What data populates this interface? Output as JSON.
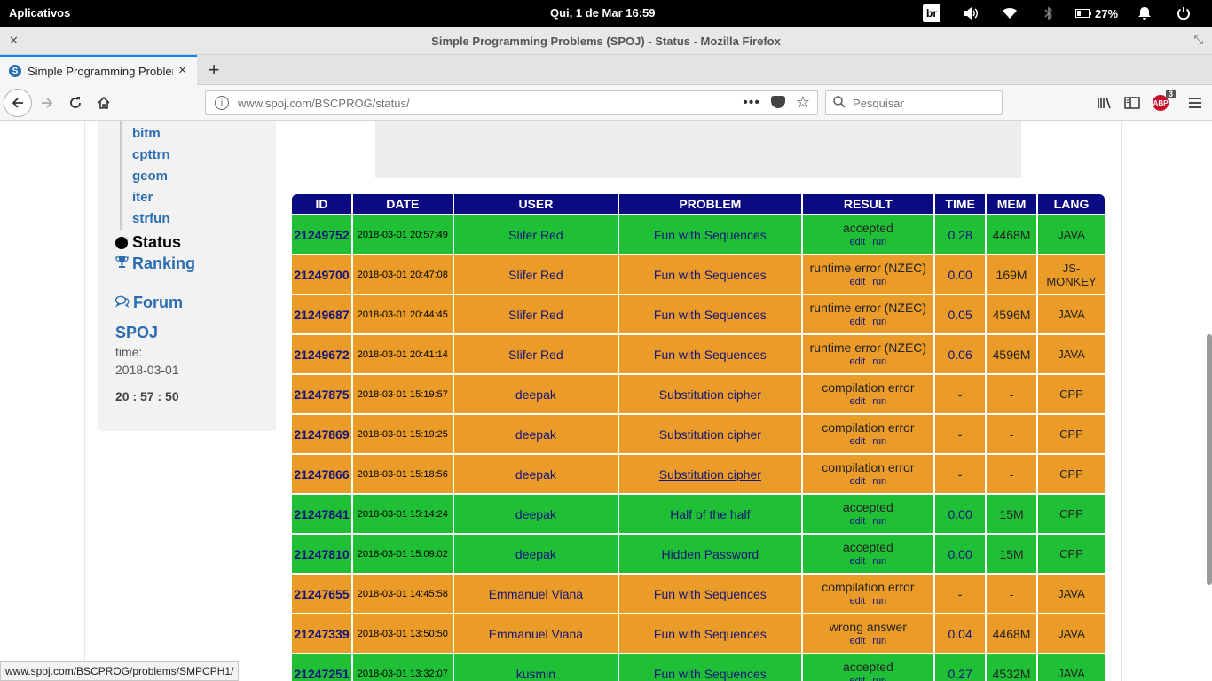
{
  "system_bar": {
    "apps_label": "Aplicativos",
    "clock": "Qui,  1 de Mar    16:59",
    "keyboard_layout": "br",
    "battery": "27%"
  },
  "window": {
    "title": "Simple Programming Problems (SPOJ) - Status - Mozilla Firefox"
  },
  "tab": {
    "title": "Simple Programming Problem",
    "favicon": "S"
  },
  "navbar": {
    "url_host": "www.spoj.com",
    "url_path": "/BSCPROG/status/",
    "search_placeholder": "Pesquisar",
    "addon_badge": "3",
    "addon_label": "ABP"
  },
  "sidebar": {
    "sub_items": [
      "bitm",
      "cpttrn",
      "geom",
      "iter",
      "strfun"
    ],
    "status_label": "Status",
    "ranking_label": "Ranking",
    "forum_label": "Forum",
    "spoj_title": "SPOJ",
    "time_label": "time:",
    "date": "2018-03-01",
    "clock": "20 : 57 : 50"
  },
  "table": {
    "headers": [
      "ID",
      "DATE",
      "USER",
      "PROBLEM",
      "RESULT",
      "TIME",
      "MEM",
      "LANG"
    ],
    "edit_label": "edit",
    "run_label": "run",
    "rows": [
      {
        "id": "21249752",
        "date": "2018-03-01 20:57:49",
        "user": "Slifer Red",
        "problem": "Fun with Sequences",
        "result": "accepted",
        "time": "0.28",
        "mem": "4468M",
        "lang": "JAVA",
        "status": "ok"
      },
      {
        "id": "21249700",
        "date": "2018-03-01 20:47:08",
        "user": "Slifer Red",
        "problem": "Fun with Sequences",
        "result": "runtime error (NZEC)",
        "time": "0.00",
        "mem": "169M",
        "lang": "JS-MONKEY",
        "status": "bad"
      },
      {
        "id": "21249687",
        "date": "2018-03-01 20:44:45",
        "user": "Slifer Red",
        "problem": "Fun with Sequences",
        "result": "runtime error (NZEC)",
        "time": "0.05",
        "mem": "4596M",
        "lang": "JAVA",
        "status": "bad"
      },
      {
        "id": "21249672",
        "date": "2018-03-01 20:41:14",
        "user": "Slifer Red",
        "problem": "Fun with Sequences",
        "result": "runtime error (NZEC)",
        "time": "0.06",
        "mem": "4596M",
        "lang": "JAVA",
        "status": "bad"
      },
      {
        "id": "21247875",
        "date": "2018-03-01 15:19:57",
        "user": "deepak",
        "problem": "Substitution cipher",
        "result": "compilation error",
        "time": "-",
        "mem": "-",
        "lang": "CPP",
        "status": "bad"
      },
      {
        "id": "21247869",
        "date": "2018-03-01 15:19:25",
        "user": "deepak",
        "problem": "Substitution cipher",
        "result": "compilation error",
        "time": "-",
        "mem": "-",
        "lang": "CPP",
        "status": "bad"
      },
      {
        "id": "21247866",
        "date": "2018-03-01 15:18:56",
        "user": "deepak",
        "problem": "Substitution cipher",
        "result": "compilation error",
        "time": "-",
        "mem": "-",
        "lang": "CPP",
        "status": "bad"
      },
      {
        "id": "21247841",
        "date": "2018-03-01 15:14:24",
        "user": "deepak",
        "problem": "Half of the half",
        "result": "accepted",
        "time": "0.00",
        "mem": "15M",
        "lang": "CPP",
        "status": "ok"
      },
      {
        "id": "21247810",
        "date": "2018-03-01 15:09:02",
        "user": "deepak",
        "problem": "Hidden Password",
        "result": "accepted",
        "time": "0.00",
        "mem": "15M",
        "lang": "CPP",
        "status": "ok"
      },
      {
        "id": "21247655",
        "date": "2018-03-01 14:45:58",
        "user": "Emmanuel Viana",
        "problem": "Fun with Sequences",
        "result": "compilation error",
        "time": "-",
        "mem": "-",
        "lang": "JAVA",
        "status": "bad"
      },
      {
        "id": "21247339",
        "date": "2018-03-01 13:50:50",
        "user": "Emmanuel Viana",
        "problem": "Fun with Sequences",
        "result": "wrong answer",
        "time": "0.04",
        "mem": "4468M",
        "lang": "JAVA",
        "status": "bad"
      },
      {
        "id": "21247251",
        "date": "2018-03-01 13:32:07",
        "user": "kusmin",
        "problem": "Fun with Sequences",
        "result": "accepted",
        "time": "0.27",
        "mem": "4532M",
        "lang": "JAVA",
        "status": "ok"
      }
    ]
  },
  "status_bar": {
    "link": "www.spoj.com/BSCPROG/problems/SMPCPH1/"
  },
  "colors": {
    "accepted_row": "#1fc036",
    "error_row": "#eb9b27",
    "header_bg": "#0a0a82",
    "link": "#2a6db0"
  },
  "icons": [
    "power-icon",
    "bell-icon",
    "battery-icon",
    "bluetooth-icon",
    "wifi-icon",
    "volume-icon",
    "trophy-icon",
    "comments-icon",
    "back-arrow-icon",
    "forward-arrow-icon",
    "reload-icon",
    "home-icon",
    "info-icon",
    "more-dots-icon",
    "pocket-icon",
    "star-icon",
    "search-icon",
    "library-icon",
    "sidebar-icon",
    "menu-icon"
  ]
}
